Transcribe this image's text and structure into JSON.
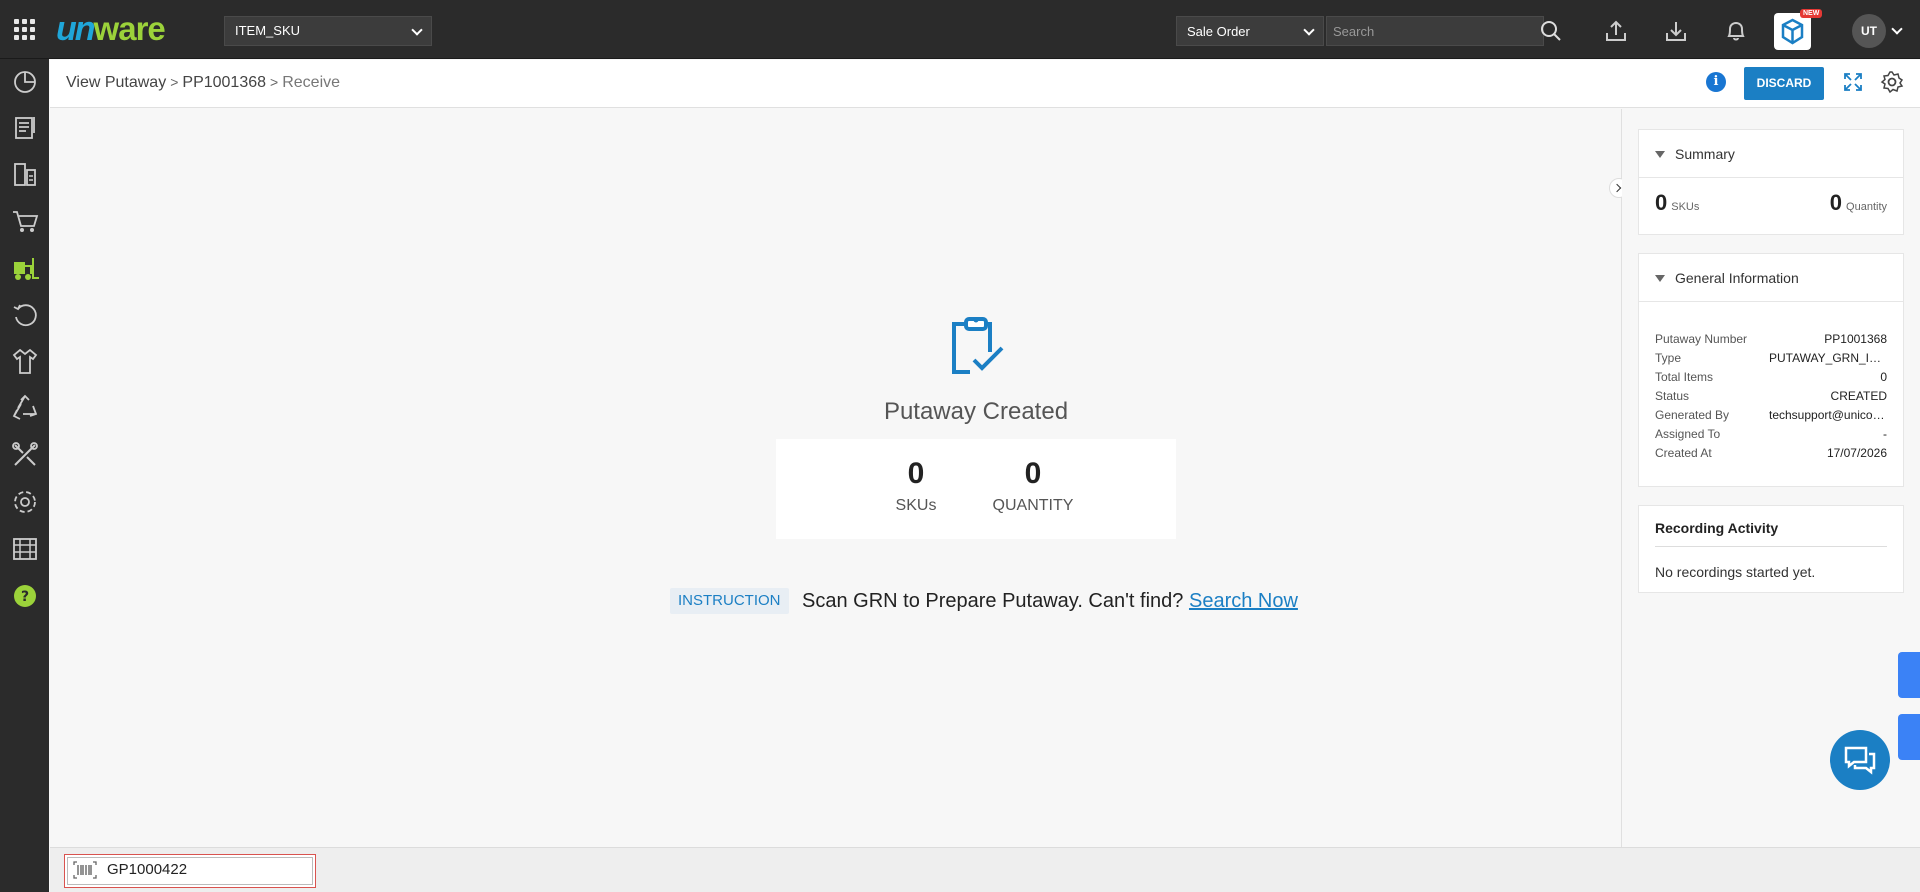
{
  "topbar": {
    "facility": "ITEM_SKU",
    "search_type": "Sale Order",
    "search_placeholder": "Search",
    "new_badge": "NEW",
    "avatar_initials": "UT",
    "logo_prefix": "un",
    "logo_suffix": "ware"
  },
  "sidebar": {
    "icons": [
      "dashboard-icon",
      "orders-icon",
      "warehouse-icon",
      "cart-icon",
      "forklift-icon",
      "returns-icon",
      "apparel-icon",
      "recycle-icon",
      "tools-icon",
      "settings-icon",
      "shelves-icon",
      "help-icon"
    ]
  },
  "breadcrumb": {
    "level1": "View Putaway",
    "level2": "PP1001368",
    "level3": "Receive",
    "separator": ">"
  },
  "actions": {
    "discard_label": "DISCARD"
  },
  "main": {
    "title": "Putaway Created",
    "skus_value": "0",
    "skus_label": "SKUs",
    "quantity_value": "0",
    "quantity_label": "QUANTITY",
    "instruction_badge": "INSTRUCTION",
    "instruction_text": "Scan GRN to Prepare Putaway. Can't find?",
    "instruction_link": "Search Now"
  },
  "summary": {
    "title": "Summary",
    "skus_value": "0",
    "skus_label": "SKUs",
    "quantity_value": "0",
    "quantity_label": "Quantity"
  },
  "general_info": {
    "title": "General Information",
    "rows": [
      {
        "key": "Putaway Number",
        "value": "PP1001368"
      },
      {
        "key": "Type",
        "value": "PUTAWAY_GRN_ITEM"
      },
      {
        "key": "Total Items",
        "value": "0"
      },
      {
        "key": "Status",
        "value": "CREATED"
      },
      {
        "key": "Generated By",
        "value": "techsupport@unicommerce.com"
      },
      {
        "key": "Assigned To",
        "value": "-"
      },
      {
        "key": "Created At",
        "value": "17/07/2026"
      }
    ]
  },
  "recording": {
    "title": "Recording Activity",
    "empty_text": "No recordings started yet."
  },
  "scanner": {
    "value": "GP1000422"
  },
  "colors": {
    "accent": "#1b7fc4",
    "topbar": "#2b2b2b",
    "logo_blue": "#1fa6d9",
    "logo_green": "#9bd23a"
  }
}
